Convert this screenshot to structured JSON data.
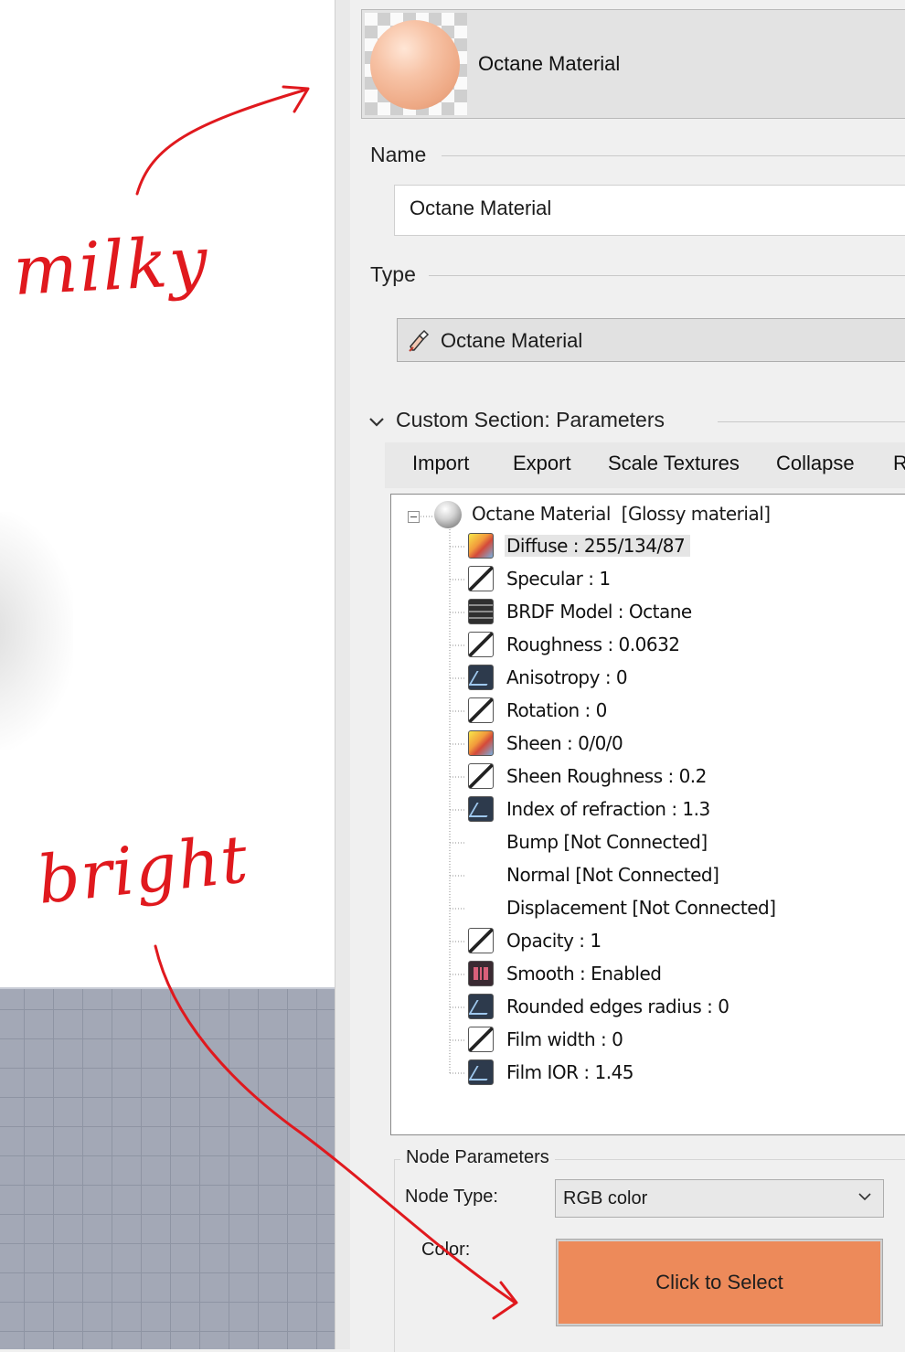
{
  "material": {
    "title": "Octane Material"
  },
  "name_section": {
    "label": "Name",
    "value": "Octane Material"
  },
  "type_section": {
    "label": "Type",
    "value": "Octane Material",
    "icon": "paint-brush-icon"
  },
  "custom_section": {
    "label": "Custom Section: Parameters",
    "toolbar": [
      "Import",
      "Export",
      "Scale Textures",
      "Collapse",
      "R"
    ]
  },
  "tree": {
    "root": {
      "name": "Octane Material",
      "kind": "[Glossy material]"
    },
    "nodes": [
      {
        "label": "Diffuse : 255/134/87",
        "icon": "color-gradient-icon",
        "selected": true
      },
      {
        "label": "Specular : 1",
        "icon": "float-texture-icon"
      },
      {
        "label": "BRDF Model : Octane",
        "icon": "enum-icon"
      },
      {
        "label": "Roughness : 0.0632",
        "icon": "float-texture-icon"
      },
      {
        "label": "Anisotropy : 0",
        "icon": "float-value-icon"
      },
      {
        "label": "Rotation : 0",
        "icon": "float-texture-icon"
      },
      {
        "label": "Sheen : 0/0/0",
        "icon": "color-gradient-icon"
      },
      {
        "label": "Sheen Roughness : 0.2",
        "icon": "float-texture-icon"
      },
      {
        "label": "Index of refraction : 1.3",
        "icon": "float-value-icon"
      },
      {
        "label": "Bump  [Not Connected]",
        "icon": ""
      },
      {
        "label": "Normal  [Not Connected]",
        "icon": ""
      },
      {
        "label": "Displacement  [Not Connected]",
        "icon": ""
      },
      {
        "label": "Opacity : 1",
        "icon": "float-texture-icon"
      },
      {
        "label": "Smooth : Enabled",
        "icon": "bool-icon"
      },
      {
        "label": "Rounded edges radius : 0",
        "icon": "float-value-icon"
      },
      {
        "label": "Film width : 0",
        "icon": "float-texture-icon"
      },
      {
        "label": "Film IOR : 1.45",
        "icon": "float-value-icon"
      }
    ]
  },
  "node_parameters": {
    "title": "Node Parameters",
    "node_type_label": "Node Type:",
    "node_type_value": "RGB color",
    "color_label": "Color:",
    "color_button": "Click to Select",
    "color_hex": "#ed8a5a"
  },
  "annotations": {
    "top_note": "milky",
    "bottom_note": "bright",
    "ink_color": "#e0191e"
  }
}
